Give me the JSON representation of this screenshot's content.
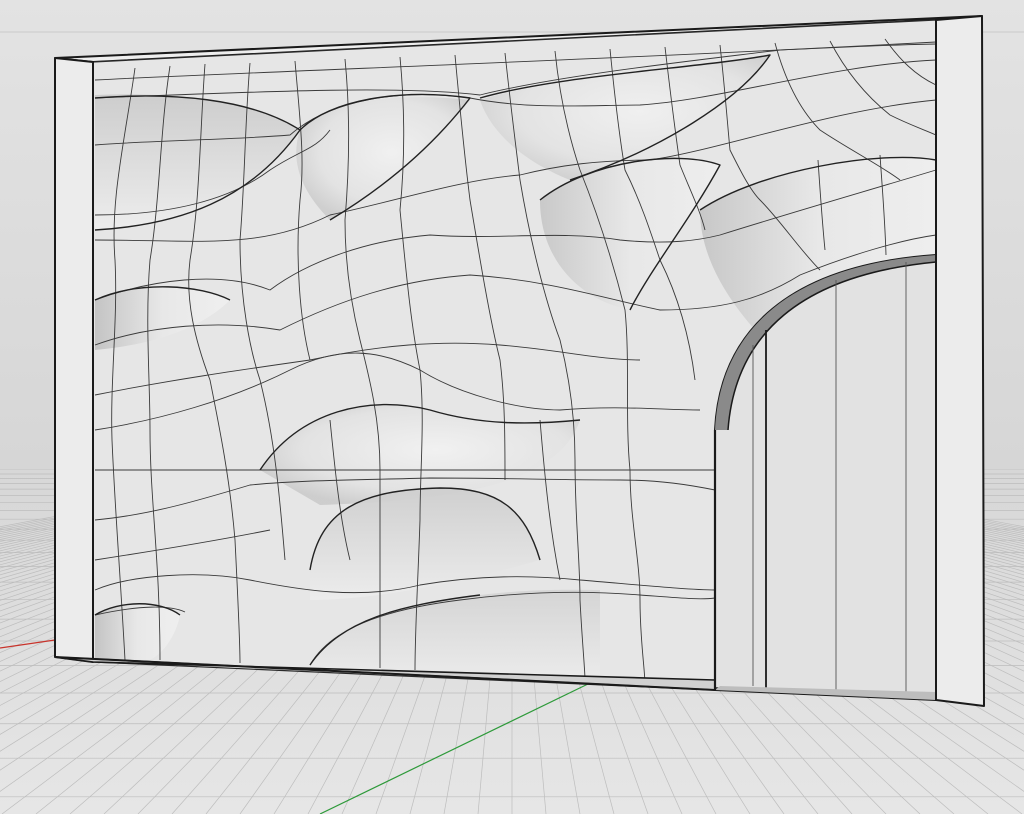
{
  "viewport": {
    "view_mode": "shaded",
    "background_color": "#dddddd",
    "construction_grid": "on",
    "world_axes": "on",
    "x_axis_color": "#c8332b",
    "y_axis_color": "#2e9a3a"
  },
  "model": {
    "wall_fill": "#e9e9e9",
    "edge_color": "#1a1a1a",
    "isocurve_color": "#3a3a3a"
  }
}
